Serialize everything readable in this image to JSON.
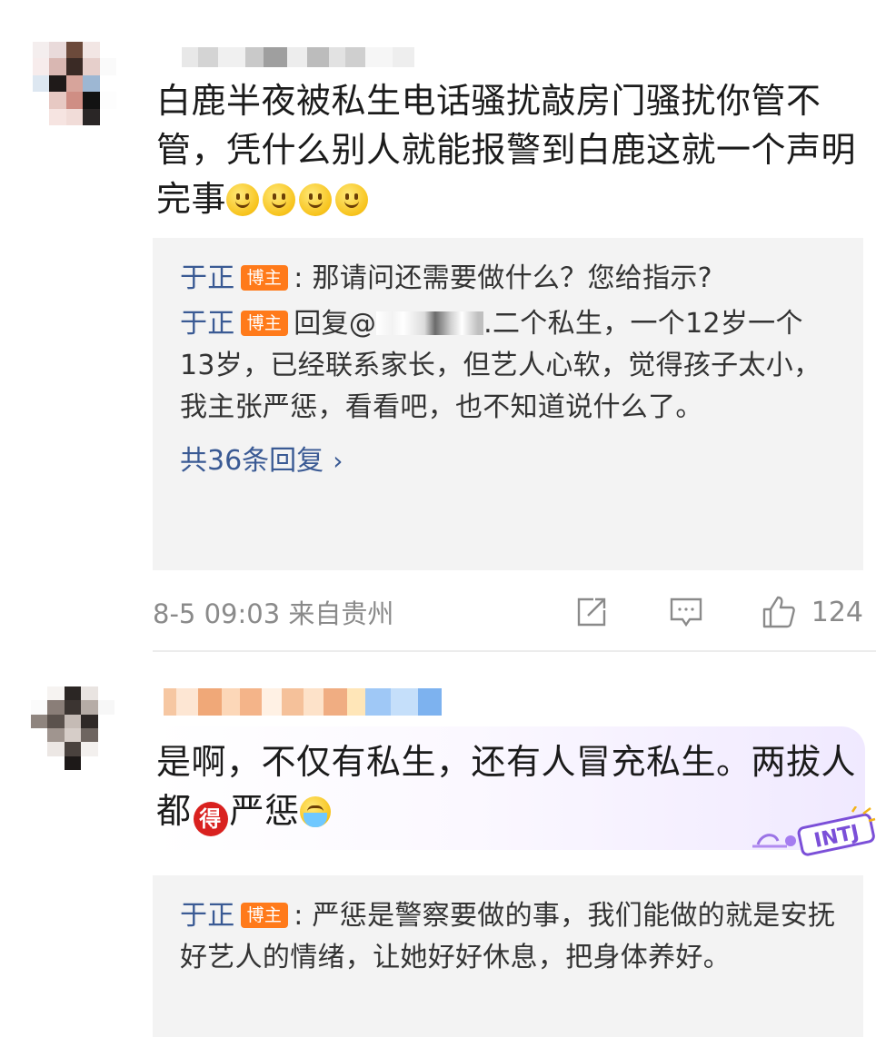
{
  "comments": [
    {
      "text": "白鹿半夜被私生电话骚扰敲房门骚扰你管不管，凭什么别人就能报警到白鹿这就一个声明完事",
      "emoji_count": 4,
      "emoji_icon": "slight-smile-emoji",
      "replies": [
        {
          "name": "于正",
          "badge": "博主",
          "separator": ":",
          "text": " 那请问还需要做什么？您给指示?"
        },
        {
          "name": "于正",
          "badge": "博主",
          "prefix": "回复@",
          "masked_tail": ".",
          "text": "二个私生，一个12岁一个13岁，已经联系家长，但艺人心软，觉得孩子太小，我主张严惩，看看吧，也不知道说什么了。"
        }
      ],
      "more_replies": "共36条回复",
      "more_chevron": "›",
      "timestamp": "8-5 09:03",
      "location": "来自贵州",
      "like_count": "124"
    },
    {
      "text_part1": "是啊，不仅有私生，还有人冒充私生。两拔人都",
      "de_badge": "得",
      "text_part2": "严惩",
      "emoji_icon": "crying-emoji",
      "sticker_text": "INTJ",
      "replies": [
        {
          "name": "于正",
          "badge": "博主",
          "separator": ":",
          "text": " 严惩是警察要做的事，我们能做的就是安抚好艺人的情绪，让她好好休息，把身体养好。"
        }
      ]
    }
  ],
  "colors": {
    "username_link": "#3a5a94",
    "badge_orange": "#ff7a1a",
    "reply_bg": "#f3f3f3",
    "meta_gray": "#8a8a8a",
    "de_badge_red": "#d9211f"
  }
}
